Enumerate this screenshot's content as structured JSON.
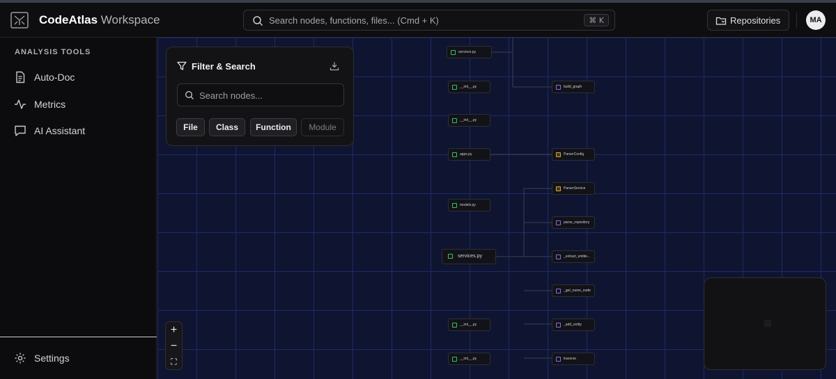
{
  "header": {
    "brand_main": "CodeAtlas",
    "brand_sub": " Workspace",
    "search_placeholder": "Search nodes, functions, files... (Cmd + K)",
    "search_shortcut": "⌘ K",
    "repositories_label": "Repositories",
    "avatar_initials": "MA"
  },
  "sidebar": {
    "section_title": "ANALYSIS TOOLS",
    "items": [
      {
        "label": "Auto-Doc",
        "icon": "document-icon"
      },
      {
        "label": "Metrics",
        "icon": "activity-icon"
      },
      {
        "label": "AI Assistant",
        "icon": "chat-icon"
      }
    ],
    "settings_label": "Settings"
  },
  "filter_panel": {
    "title": "Filter & Search",
    "search_placeholder": "Search nodes...",
    "chips": [
      {
        "label": "File",
        "active": true
      },
      {
        "label": "Class",
        "active": true
      },
      {
        "label": "Function",
        "active": true
      },
      {
        "label": "Module",
        "active": false
      }
    ]
  },
  "zoom": {
    "plus": "+",
    "minus": "−",
    "fit": "⛶"
  },
  "graph": {
    "nodes": [
      {
        "id": "n1",
        "label": "services.py",
        "kind": "file"
      },
      {
        "id": "n2",
        "label": "__init__.py",
        "kind": "file"
      },
      {
        "id": "n3",
        "label": "build_graph",
        "kind": "fn"
      },
      {
        "id": "n4",
        "label": "__init__.py",
        "kind": "file"
      },
      {
        "id": "n5",
        "label": "apps.py",
        "kind": "file"
      },
      {
        "id": "n6",
        "label": "ParserConfig",
        "kind": "cls"
      },
      {
        "id": "n7",
        "label": "ParserService",
        "kind": "cls"
      },
      {
        "id": "n8",
        "label": "models.py",
        "kind": "file"
      },
      {
        "id": "n9",
        "label": "parse_repository",
        "kind": "fn"
      },
      {
        "id": "n10",
        "label": "services.py",
        "kind": "file"
      },
      {
        "id": "n11",
        "label": "_extract_entitie...",
        "kind": "fn"
      },
      {
        "id": "n12",
        "label": "_get_name_node",
        "kind": "fn"
      },
      {
        "id": "n13",
        "label": "__init__.py",
        "kind": "file"
      },
      {
        "id": "n14",
        "label": "_add_entity",
        "kind": "fn"
      },
      {
        "id": "n15",
        "label": "__init__.py",
        "kind": "file"
      },
      {
        "id": "n16",
        "label": "traverse",
        "kind": "fn"
      }
    ]
  },
  "colors": {
    "canvas_bg": "#0f1530",
    "grid": "#1d2a6a",
    "file_icon": "#3fbf6a",
    "function_icon": "#8b6cf0",
    "class_icon": "#e0a53a"
  }
}
